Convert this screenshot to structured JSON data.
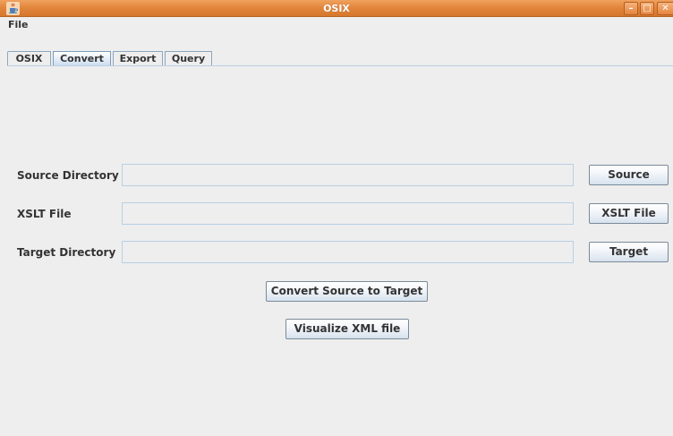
{
  "window": {
    "title": "OSIX",
    "minimize_glyph": "–",
    "maximize_glyph": "□",
    "close_glyph": "✕",
    "app_icon": "java-cup-icon",
    "titlebar_color": "#e3873d"
  },
  "menubar": {
    "items": [
      {
        "label": "File"
      }
    ]
  },
  "tabs": [
    {
      "label": "OSIX",
      "active": false
    },
    {
      "label": "Convert",
      "active": true
    },
    {
      "label": "Export",
      "active": false
    },
    {
      "label": "Query",
      "active": false
    }
  ],
  "convert_panel": {
    "source": {
      "label": "Source Directory",
      "value": "",
      "button_label": "Source"
    },
    "xslt": {
      "label": "XSLT File",
      "value": "",
      "button_label": "XSLT File"
    },
    "target": {
      "label": "Target Directory",
      "value": "",
      "button_label": "Target"
    },
    "convert_button_label": "Convert Source to Target",
    "visualize_button_label": "Visualize XML file"
  },
  "colors": {
    "accent": "#b8cfe5",
    "active_tab": "#c9dbee",
    "background": "#eeeeee"
  }
}
